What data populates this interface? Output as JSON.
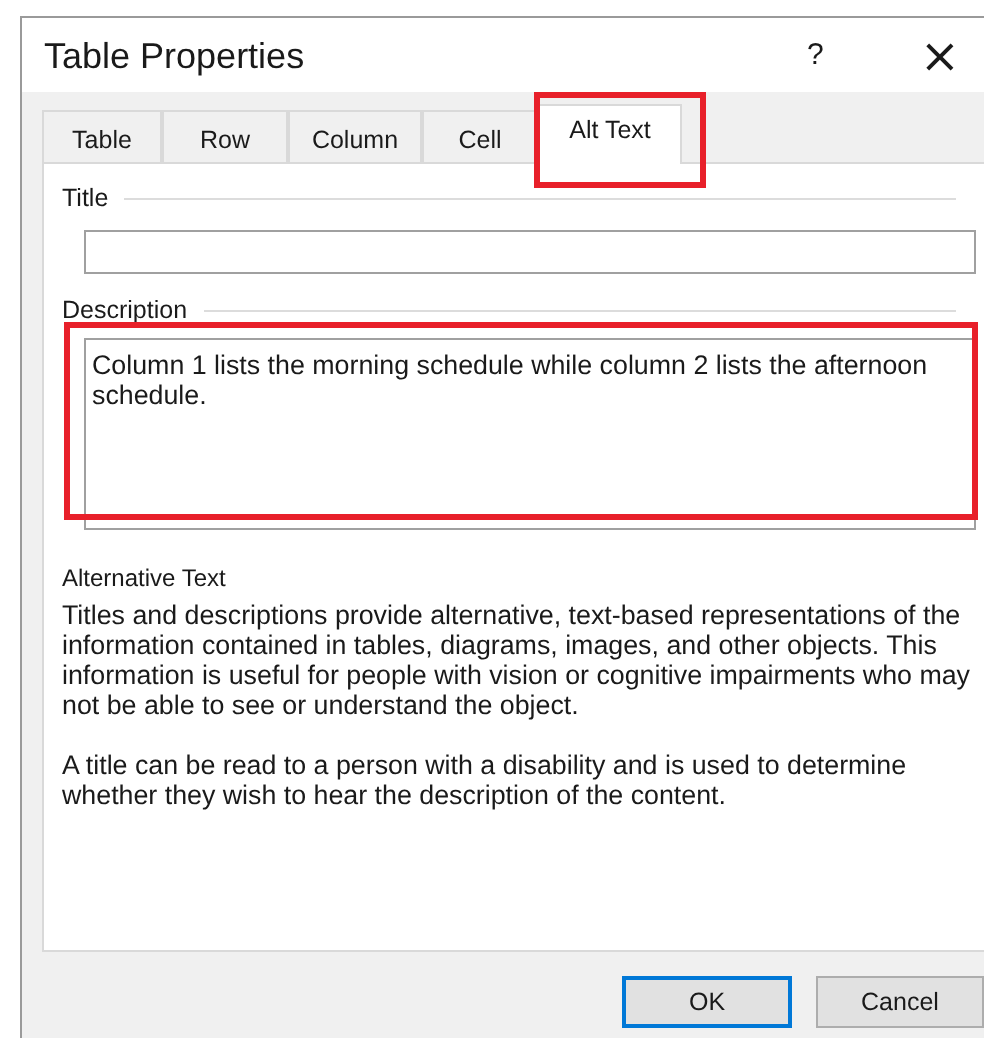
{
  "window": {
    "title": "Table Properties",
    "help": "?",
    "close": "×"
  },
  "tabs": [
    {
      "label": "Table",
      "selected": false,
      "highlighted": false
    },
    {
      "label": "Row",
      "selected": false,
      "highlighted": false
    },
    {
      "label": "Column",
      "selected": false,
      "highlighted": false
    },
    {
      "label": "Cell",
      "selected": false,
      "highlighted": false
    },
    {
      "label": "Alt Text",
      "selected": true,
      "highlighted": true
    }
  ],
  "title_field": {
    "label": "Title"
  },
  "description_field": {
    "label": "Description",
    "value": "Column 1 lists the morning schedule while column 2 lists the afternoon schedule.",
    "highlighted": true
  },
  "help_heading": "Alternative Text",
  "help_paragraphs": [
    "Titles and descriptions provide alternative, text-based representations of the information contained in tables, diagrams, images, and other objects. This information is useful for people with vision or cognitive impairments who may not be able to see or understand the object.",
    "A title can be read to a person with a disability and is used to determine whether they wish to hear the description of the content."
  ],
  "buttons": [
    {
      "label": "OK",
      "default": true
    },
    {
      "label": "Cancel",
      "default": false
    }
  ]
}
